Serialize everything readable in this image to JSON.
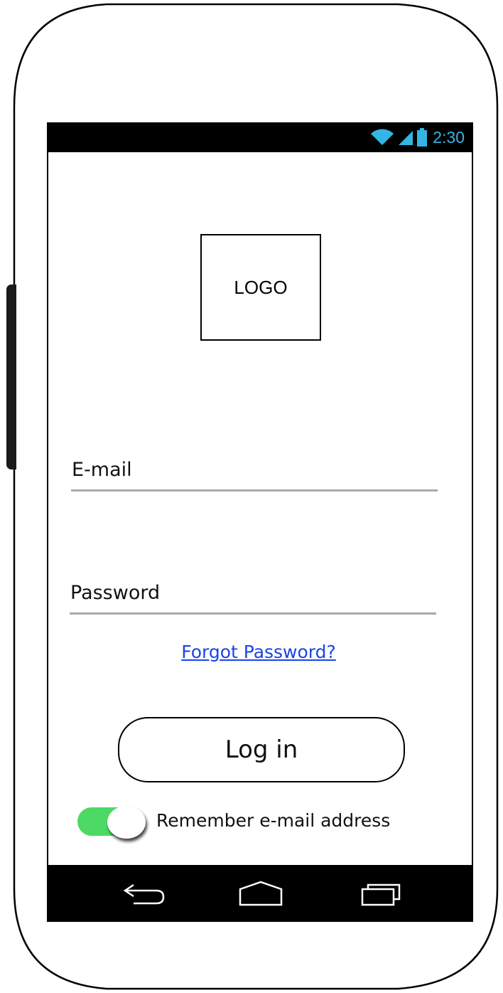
{
  "status_bar": {
    "time": "2:30",
    "icons": [
      "wifi-icon",
      "signal-icon",
      "battery-icon"
    ],
    "accent_color": "#33b5e5"
  },
  "logo": {
    "text": "LOGO"
  },
  "form": {
    "email_label": "E-mail",
    "password_label": "Password",
    "forgot_password_link": "Forgot Password?",
    "login_button": "Log in",
    "remember_toggle": {
      "label": "Remember e-mail address",
      "on": true,
      "color": "#4cd964"
    }
  },
  "nav_bar": {
    "buttons": [
      "back-icon",
      "home-icon",
      "recents-icon"
    ]
  },
  "colors": {
    "link": "#1a44e8",
    "field_underline": "#aaaaaa"
  }
}
